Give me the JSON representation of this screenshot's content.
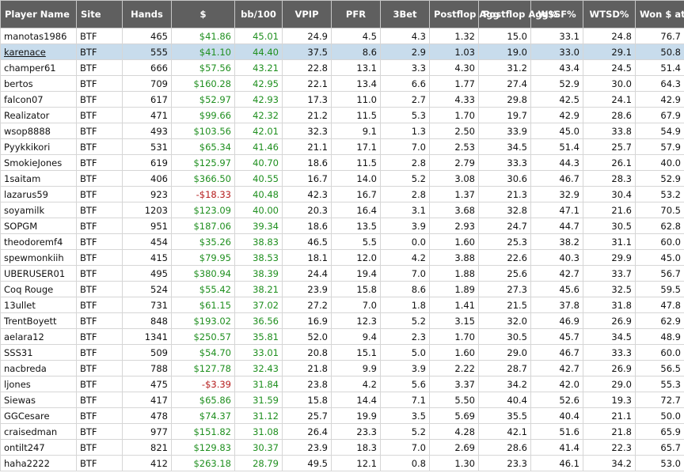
{
  "columns": [
    "Player Name",
    "Site",
    "Hands",
    "$",
    "bb/100",
    "VPIP",
    "PFR",
    "3Bet",
    "Postflop Agg",
    "Postflop Agg%",
    "W$SF%",
    "WTSD%",
    "Won $ at SD"
  ],
  "selected_row": 1,
  "rows": [
    [
      "manotas1986",
      "BTF",
      "465",
      "$41.86",
      "45.01",
      "24.9",
      "4.5",
      "4.3",
      "1.32",
      "15.0",
      "33.1",
      "24.8",
      "76.7"
    ],
    [
      "karenace",
      "BTF",
      "555",
      "$41.10",
      "44.40",
      "37.5",
      "8.6",
      "2.9",
      "1.03",
      "19.0",
      "33.0",
      "29.1",
      "50.8"
    ],
    [
      "champer61",
      "BTF",
      "666",
      "$57.56",
      "43.21",
      "22.8",
      "13.1",
      "3.3",
      "4.30",
      "31.2",
      "43.4",
      "24.5",
      "51.4"
    ],
    [
      "bertos",
      "BTF",
      "709",
      "$160.28",
      "42.95",
      "22.1",
      "13.4",
      "6.6",
      "1.77",
      "27.4",
      "52.9",
      "30.0",
      "64.3"
    ],
    [
      "falcon07",
      "BTF",
      "617",
      "$52.97",
      "42.93",
      "17.3",
      "11.0",
      "2.7",
      "4.33",
      "29.8",
      "42.5",
      "24.1",
      "42.9"
    ],
    [
      "Realizator",
      "BTF",
      "471",
      "$99.66",
      "42.32",
      "21.2",
      "11.5",
      "5.3",
      "1.70",
      "19.7",
      "42.9",
      "28.6",
      "67.9"
    ],
    [
      "wsop8888",
      "BTF",
      "493",
      "$103.56",
      "42.01",
      "32.3",
      "9.1",
      "1.3",
      "2.50",
      "33.9",
      "45.0",
      "33.8",
      "54.9"
    ],
    [
      "Pyykkikori",
      "BTF",
      "531",
      "$65.34",
      "41.46",
      "21.1",
      "17.1",
      "7.0",
      "2.53",
      "34.5",
      "51.4",
      "25.7",
      "57.9"
    ],
    [
      "SmokieJones",
      "BTF",
      "619",
      "$125.97",
      "40.70",
      "18.6",
      "11.5",
      "2.8",
      "2.79",
      "33.3",
      "44.3",
      "26.1",
      "40.0"
    ],
    [
      "1saitam",
      "BTF",
      "406",
      "$366.50",
      "40.55",
      "16.7",
      "14.0",
      "5.2",
      "3.08",
      "30.6",
      "46.7",
      "28.3",
      "52.9"
    ],
    [
      "lazarus59",
      "BTF",
      "923",
      "-$18.33",
      "40.48",
      "42.3",
      "16.7",
      "2.8",
      "1.37",
      "21.3",
      "32.9",
      "30.4",
      "53.2"
    ],
    [
      "soyamilk",
      "BTF",
      "1203",
      "$123.09",
      "40.00",
      "20.3",
      "16.4",
      "3.1",
      "3.68",
      "32.8",
      "47.1",
      "21.6",
      "70.5"
    ],
    [
      "SOPGM",
      "BTF",
      "951",
      "$187.06",
      "39.34",
      "18.6",
      "13.5",
      "3.9",
      "2.93",
      "24.7",
      "44.7",
      "30.5",
      "62.8"
    ],
    [
      "theodoremf4",
      "BTF",
      "454",
      "$35.26",
      "38.83",
      "46.5",
      "5.5",
      "0.0",
      "1.60",
      "25.3",
      "38.2",
      "31.1",
      "60.0"
    ],
    [
      "spewmonkiih",
      "BTF",
      "415",
      "$79.95",
      "38.53",
      "18.1",
      "12.0",
      "4.2",
      "3.88",
      "22.6",
      "40.3",
      "29.9",
      "45.0"
    ],
    [
      "UBERUSER01",
      "BTF",
      "495",
      "$380.94",
      "38.39",
      "24.4",
      "19.4",
      "7.0",
      "1.88",
      "25.6",
      "42.7",
      "33.7",
      "56.7"
    ],
    [
      "Coq Rouge",
      "BTF",
      "524",
      "$55.42",
      "38.21",
      "23.9",
      "15.8",
      "8.6",
      "1.89",
      "27.3",
      "45.6",
      "32.5",
      "59.5"
    ],
    [
      "13ullet",
      "BTF",
      "731",
      "$61.15",
      "37.02",
      "27.2",
      "7.0",
      "1.8",
      "1.41",
      "21.5",
      "37.8",
      "31.8",
      "47.8"
    ],
    [
      "TrentBoyett",
      "BTF",
      "848",
      "$193.02",
      "36.56",
      "16.9",
      "12.3",
      "5.2",
      "3.15",
      "32.0",
      "46.9",
      "26.9",
      "62.9"
    ],
    [
      "aelara12",
      "BTF",
      "1341",
      "$250.57",
      "35.81",
      "52.0",
      "9.4",
      "2.3",
      "1.70",
      "30.5",
      "45.7",
      "34.5",
      "48.9"
    ],
    [
      "SSS31",
      "BTF",
      "509",
      "$54.70",
      "33.01",
      "20.8",
      "15.1",
      "5.0",
      "1.60",
      "29.0",
      "46.7",
      "33.3",
      "60.0"
    ],
    [
      "nacbreda",
      "BTF",
      "788",
      "$127.78",
      "32.43",
      "21.8",
      "9.9",
      "3.9",
      "2.22",
      "28.7",
      "42.7",
      "26.9",
      "56.5"
    ],
    [
      "ljones",
      "BTF",
      "475",
      "-$3.39",
      "31.84",
      "23.8",
      "4.2",
      "5.6",
      "3.37",
      "34.2",
      "42.0",
      "29.0",
      "55.3"
    ],
    [
      "Siewas",
      "BTF",
      "417",
      "$65.86",
      "31.59",
      "15.8",
      "14.4",
      "7.1",
      "5.50",
      "40.4",
      "52.6",
      "19.3",
      "72.7"
    ],
    [
      "GGCesare",
      "BTF",
      "478",
      "$74.37",
      "31.12",
      "25.7",
      "19.9",
      "3.5",
      "5.69",
      "35.5",
      "40.4",
      "21.1",
      "50.0"
    ],
    [
      "craisedman",
      "BTF",
      "977",
      "$151.82",
      "31.08",
      "26.4",
      "23.3",
      "5.2",
      "4.28",
      "42.1",
      "51.6",
      "21.8",
      "65.9"
    ],
    [
      "ontilt247",
      "BTF",
      "821",
      "$129.83",
      "30.37",
      "23.9",
      "18.3",
      "7.0",
      "2.69",
      "28.6",
      "41.4",
      "22.3",
      "65.7"
    ],
    [
      "haha2222",
      "BTF",
      "412",
      "$263.18",
      "28.79",
      "49.5",
      "12.1",
      "0.8",
      "1.30",
      "23.3",
      "46.1",
      "34.2",
      "53.0"
    ]
  ]
}
